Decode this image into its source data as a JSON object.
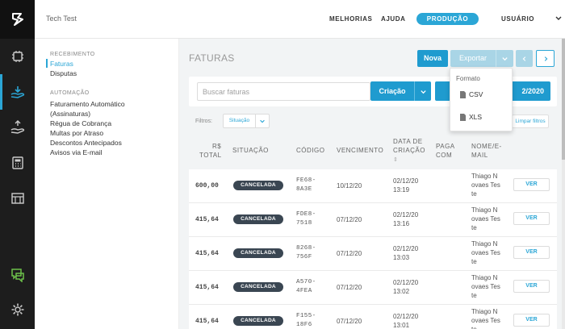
{
  "topbar": {
    "company": "Tech Test",
    "nav": [
      "MELHORIAS",
      "AJUDA"
    ],
    "environment": "PRODUÇÃO",
    "user": "USUÁRIO"
  },
  "subnav": {
    "sections": [
      {
        "title": "RECEBIMENTO",
        "items": [
          "Faturas",
          "Disputas"
        ]
      },
      {
        "title": "AUTOMAÇÃO",
        "items": [
          "Faturamento Automático",
          "(Assinaturas)",
          "Régua de Cobrança",
          "Multas por Atraso",
          "Descontos Antecipados",
          "Avisos via E-mail"
        ]
      }
    ]
  },
  "main": {
    "title": "FATURAS",
    "new_label": "Nova",
    "export_label": "Exportar",
    "search_placeholder": "Buscar faturas",
    "sort_label": "Criação",
    "date_label": "2/2020",
    "filters_label": "Filtros:",
    "filter_value": "Situação",
    "clear_label": "Limpar filtros"
  },
  "export_menu": {
    "header": "Formato",
    "options": [
      "CSV",
      "XLS"
    ]
  },
  "table": {
    "columns": [
      "R$",
      "TOTAL",
      "SITUAÇÃO",
      "CÓDIGO",
      "VENCIMENTO",
      "DATA DE",
      "CRIAÇÃO",
      "PAGA",
      "COM",
      "NOME/E-",
      "MAIL"
    ],
    "see_label": "VER",
    "rows": [
      {
        "total": "600,00",
        "status": "CANCELADA",
        "code1": "FE68-",
        "code2": "8A3E",
        "due": "10/12/20",
        "created_date": "02/12/20",
        "created_time": "13:19",
        "name1": "Thiago N",
        "name2": "ovaes Tes",
        "name3": "te"
      },
      {
        "total": "415,64",
        "status": "CANCELADA",
        "code1": "FDE8-",
        "code2": "7518",
        "due": "07/12/20",
        "created_date": "02/12/20",
        "created_time": "13:16",
        "name1": "Thiago N",
        "name2": "ovaes Tes",
        "name3": "te"
      },
      {
        "total": "415,64",
        "status": "CANCELADA",
        "code1": "8268-",
        "code2": "756F",
        "due": "07/12/20",
        "created_date": "02/12/20",
        "created_time": "13:03",
        "name1": "Thiago N",
        "name2": "ovaes Tes",
        "name3": "te"
      },
      {
        "total": "415,64",
        "status": "CANCELADA",
        "code1": "A570-",
        "code2": "4FEA",
        "due": "07/12/20",
        "created_date": "02/12/20",
        "created_time": "13:02",
        "name1": "Thiago N",
        "name2": "ovaes Tes",
        "name3": "te"
      },
      {
        "total": "415,64",
        "status": "CANCELADA",
        "code1": "F155-",
        "code2": "18F6",
        "due": "07/12/20",
        "created_date": "02/12/20",
        "created_time": "13:01",
        "name1": "Thiago N",
        "name2": "ovaes Tes",
        "name3": "te"
      }
    ]
  },
  "colors": {
    "accent": "#2ba6d6",
    "primary_button": "#1f9bcf",
    "rail": "#1d1d1d",
    "badge": "#3a4652",
    "green_icon": "#6cc04a"
  }
}
